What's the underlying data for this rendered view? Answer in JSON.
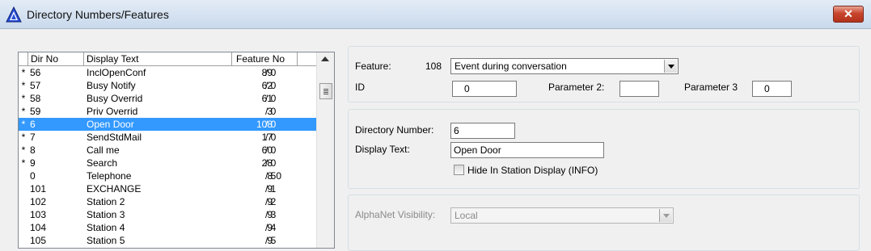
{
  "window": {
    "title": "Directory Numbers/Features",
    "close_glyph": "✕"
  },
  "list": {
    "columns": {
      "dir_no": "Dir No",
      "display_text": "Display Text",
      "feature_no": "Feature No"
    },
    "rows": [
      {
        "mark": "*",
        "dir": "56",
        "text": "InclOpenConf",
        "fno": "89",
        "par": "/ 0",
        "selected": false
      },
      {
        "mark": "*",
        "dir": "57",
        "text": "Busy Notify",
        "fno": "62",
        "par": "/ 0",
        "selected": false
      },
      {
        "mark": "*",
        "dir": "58",
        "text": "Busy Overrid",
        "fno": "61",
        "par": "/ 0",
        "selected": false
      },
      {
        "mark": "*",
        "dir": "59",
        "text": "Priv Overrid",
        "fno": "3",
        "par": "/ 0",
        "selected": false
      },
      {
        "mark": "*",
        "dir": "6",
        "text": "Open Door",
        "fno": "108",
        "par": "/ 0",
        "selected": true
      },
      {
        "mark": "*",
        "dir": "7",
        "text": "SendStdMail",
        "fno": "17",
        "par": "/ 0",
        "selected": false
      },
      {
        "mark": "*",
        "dir": "8",
        "text": "Call me",
        "fno": "60",
        "par": "/ 0",
        "selected": false
      },
      {
        "mark": "*",
        "dir": "9",
        "text": "Search",
        "fno": "28",
        "par": "/ 0",
        "selected": false
      },
      {
        "mark": "",
        "dir": "0",
        "text": "Telephone",
        "fno": "8",
        "par": "/ 50",
        "selected": false
      },
      {
        "mark": "",
        "dir": "101",
        "text": "EXCHANGE",
        "fno": "9",
        "par": "/ 1",
        "selected": false
      },
      {
        "mark": "",
        "dir": "102",
        "text": "Station 2",
        "fno": "9",
        "par": "/ 2",
        "selected": false
      },
      {
        "mark": "",
        "dir": "103",
        "text": "Station 3",
        "fno": "9",
        "par": "/ 3",
        "selected": false
      },
      {
        "mark": "",
        "dir": "104",
        "text": "Station 4",
        "fno": "9",
        "par": "/ 4",
        "selected": false
      },
      {
        "mark": "",
        "dir": "105",
        "text": "Station 5",
        "fno": "9",
        "par": "/ 5",
        "selected": false
      }
    ]
  },
  "feature_group": {
    "feature_label": "Feature:",
    "feature_number": "108",
    "feature_selected": "Event during conversation",
    "id_label": "ID",
    "id_value": "0",
    "param2_label": "Parameter 2:",
    "param2_value": "",
    "param3_label": "Parameter 3",
    "param3_value": "0"
  },
  "directory_group": {
    "dir_number_label": "Directory Number:",
    "dir_number_value": "6",
    "display_text_label": "Display Text:",
    "display_text_value": "Open Door",
    "hide_label": "Hide In Station Display (INFO)",
    "hide_checked": false
  },
  "alphanet_group": {
    "visibility_label": "AlphaNet Visibility:",
    "visibility_value": "Local"
  }
}
